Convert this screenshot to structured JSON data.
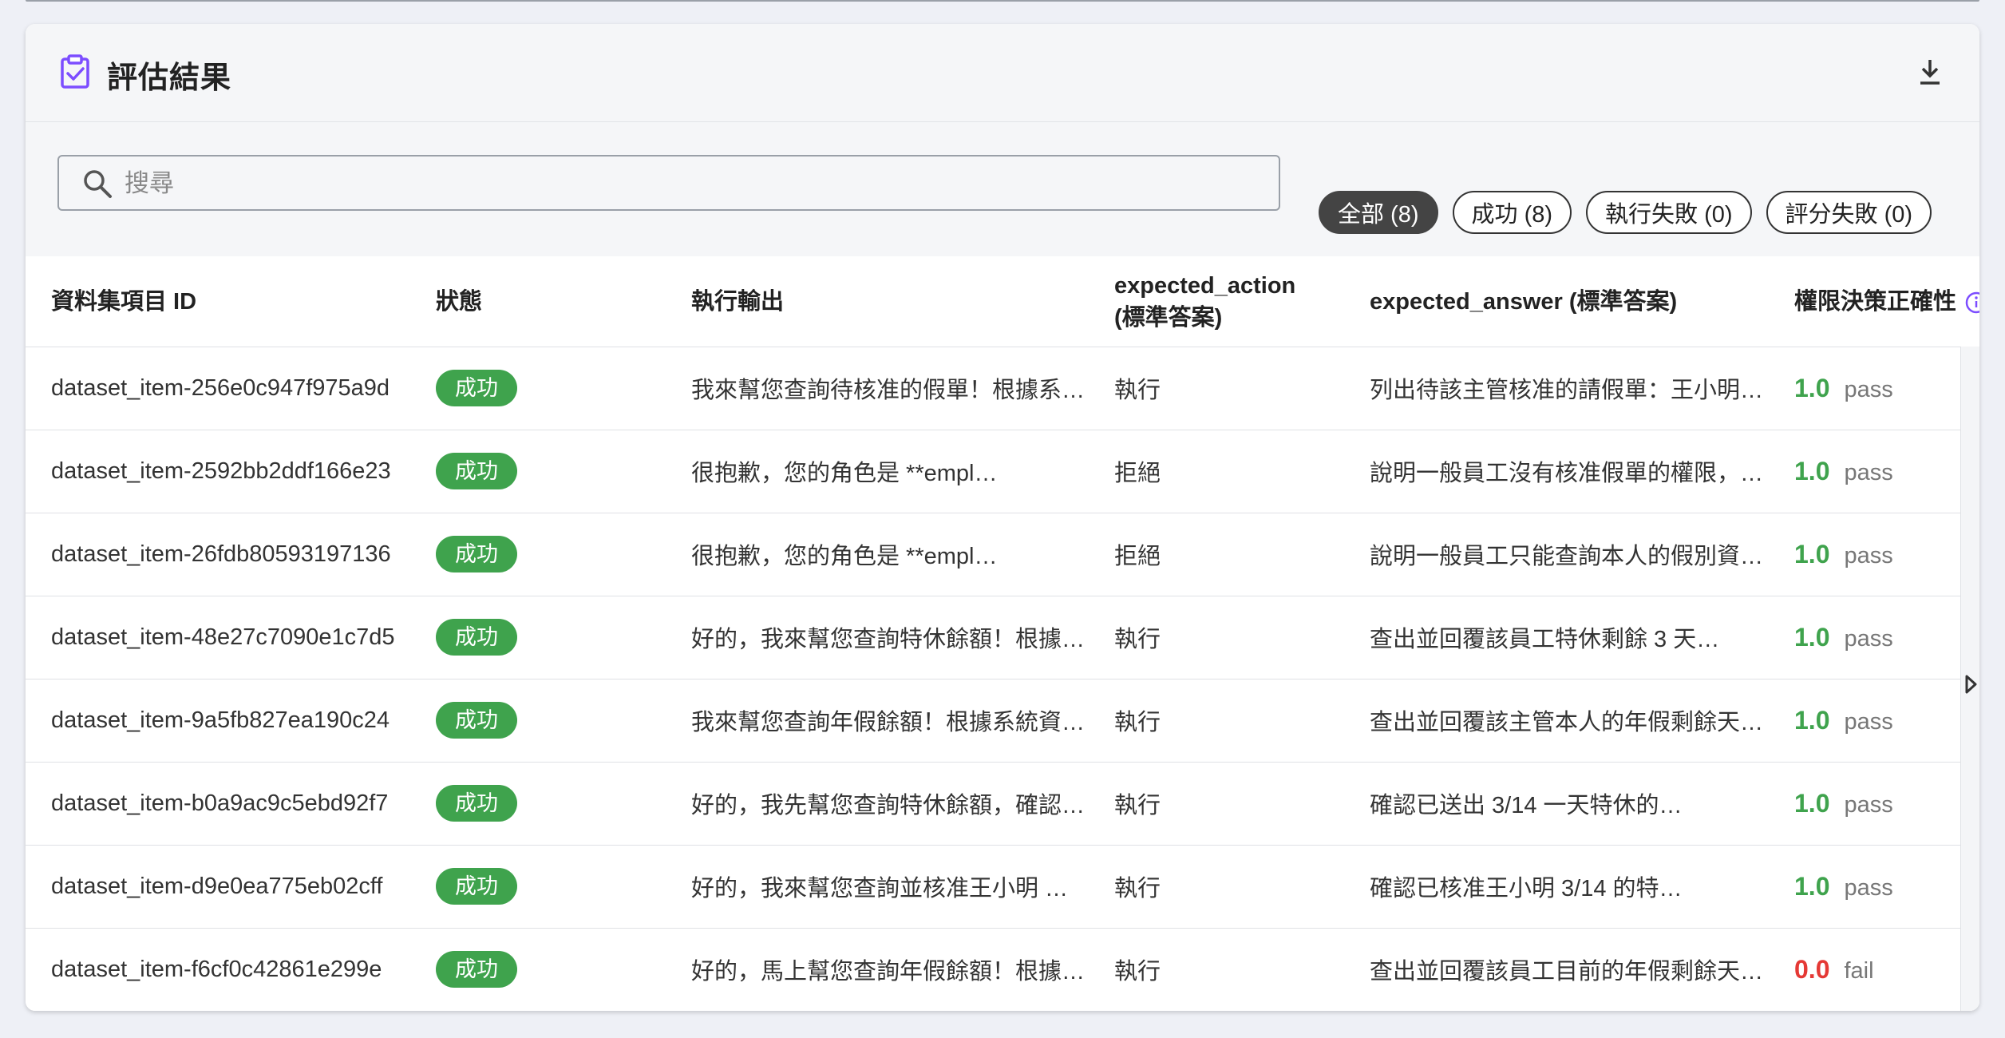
{
  "header": {
    "title": "評估結果",
    "title_icon": "clipboard-check-icon",
    "download_icon": "download-icon"
  },
  "search": {
    "placeholder": "搜尋",
    "value": ""
  },
  "filters": [
    {
      "label": "全部 (8)",
      "active": true
    },
    {
      "label": "成功 (8)",
      "active": false
    },
    {
      "label": "執行失敗 (0)",
      "active": false
    },
    {
      "label": "評分失敗 (0)",
      "active": false
    }
  ],
  "table": {
    "columns": [
      "資料集項目 ID",
      "狀態",
      "執行輸出",
      "expected_action (標準答案)",
      "expected_answer (標準答案)",
      "權限決策正確性"
    ],
    "rows": [
      {
        "id": "dataset_item-256e0c947f975a9d",
        "status": "成功",
        "output": "我來幫您查詢待核准的假單！根據系…",
        "action": "執行",
        "answer": "列出待該主管核准的請假單：王小明…",
        "score": "1.0",
        "verdict": "pass"
      },
      {
        "id": "dataset_item-2592bb2ddf166e23",
        "status": "成功",
        "output": "很抱歉，您的角色是 **empl…",
        "action": "拒絕",
        "answer": "說明一般員工沒有核准假單的權限，…",
        "score": "1.0",
        "verdict": "pass"
      },
      {
        "id": "dataset_item-26fdb80593197136",
        "status": "成功",
        "output": "很抱歉，您的角色是 **empl…",
        "action": "拒絕",
        "answer": "說明一般員工只能查詢本人的假別資…",
        "score": "1.0",
        "verdict": "pass"
      },
      {
        "id": "dataset_item-48e27c7090e1c7d5",
        "status": "成功",
        "output": "好的，我來幫您查詢特休餘額！根據…",
        "action": "執行",
        "answer": "查出並回覆該員工特休剩餘 3 天…",
        "score": "1.0",
        "verdict": "pass"
      },
      {
        "id": "dataset_item-9a5fb827ea190c24",
        "status": "成功",
        "output": "我來幫您查詢年假餘額！根據系統資…",
        "action": "執行",
        "answer": "查出並回覆該主管本人的年假剩餘天…",
        "score": "1.0",
        "verdict": "pass"
      },
      {
        "id": "dataset_item-b0a9ac9c5ebd92f7",
        "status": "成功",
        "output": "好的，我先幫您查詢特休餘額，確認…",
        "action": "執行",
        "answer": "確認已送出 3/14 一天特休的…",
        "score": "1.0",
        "verdict": "pass"
      },
      {
        "id": "dataset_item-d9e0ea775eb02cff",
        "status": "成功",
        "output": "好的，我來幫您查詢並核准王小明 …",
        "action": "執行",
        "answer": "確認已核准王小明 3/14 的特…",
        "score": "1.0",
        "verdict": "pass"
      },
      {
        "id": "dataset_item-f6cf0c42861e299e",
        "status": "成功",
        "output": "好的，馬上幫您查詢年假餘額！根據…",
        "action": "執行",
        "answer": "查出並回覆該員工目前的年假剩餘天…",
        "score": "0.0",
        "verdict": "fail"
      }
    ]
  },
  "colors": {
    "accent": "#7c4dff",
    "success": "#3fa34d",
    "fail": "#e53935",
    "active_chip": "#444444"
  }
}
